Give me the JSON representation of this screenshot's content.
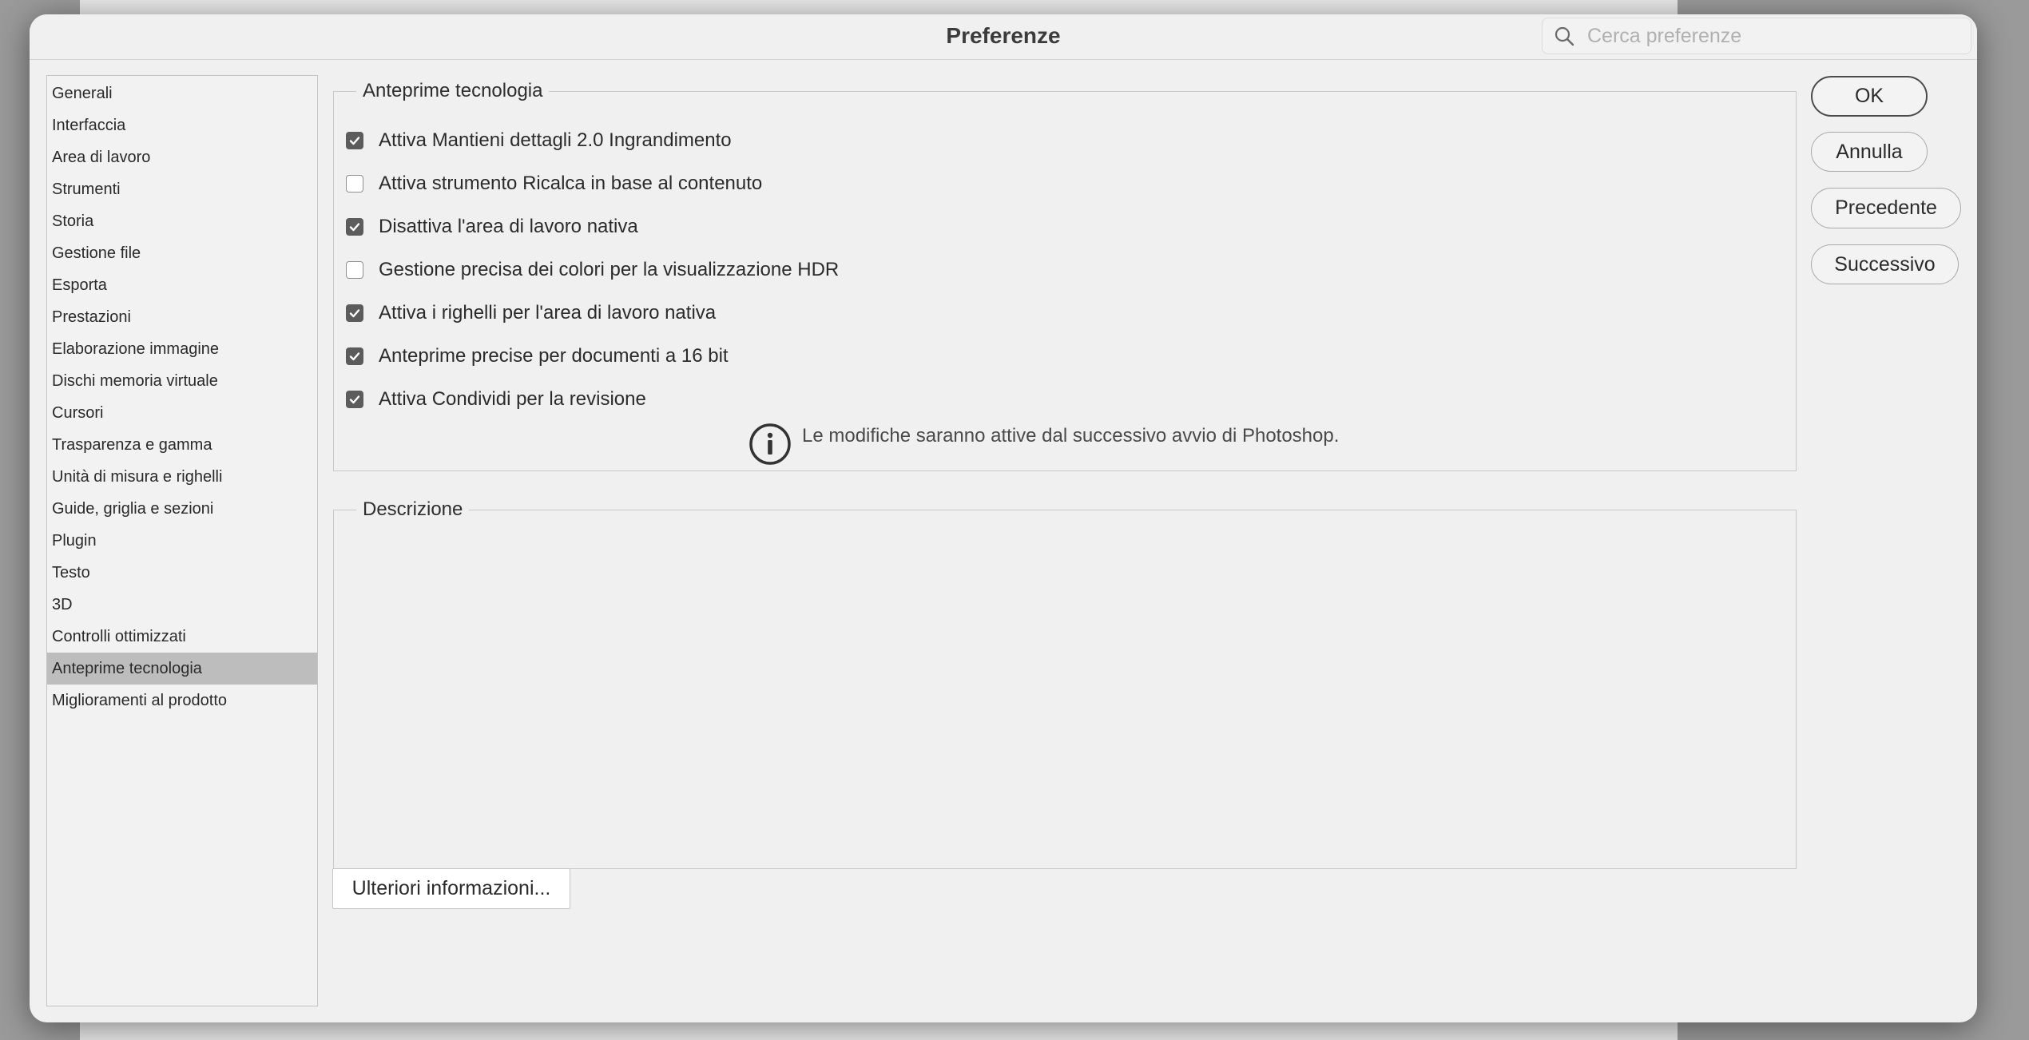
{
  "dialog": {
    "title": "Preferenze",
    "search_placeholder": "Cerca preferenze"
  },
  "sidebar": {
    "items": [
      {
        "label": "Generali",
        "selected": false
      },
      {
        "label": "Interfaccia",
        "selected": false
      },
      {
        "label": "Area di lavoro",
        "selected": false
      },
      {
        "label": "Strumenti",
        "selected": false
      },
      {
        "label": "Storia",
        "selected": false
      },
      {
        "label": "Gestione file",
        "selected": false
      },
      {
        "label": "Esporta",
        "selected": false
      },
      {
        "label": "Prestazioni",
        "selected": false
      },
      {
        "label": "Elaborazione immagine",
        "selected": false
      },
      {
        "label": "Dischi memoria virtuale",
        "selected": false
      },
      {
        "label": "Cursori",
        "selected": false
      },
      {
        "label": "Trasparenza e gamma",
        "selected": false
      },
      {
        "label": "Unità di misura e righelli",
        "selected": false
      },
      {
        "label": "Guide, griglia e sezioni",
        "selected": false
      },
      {
        "label": "Plugin",
        "selected": false
      },
      {
        "label": "Testo",
        "selected": false
      },
      {
        "label": "3D",
        "selected": false
      },
      {
        "label": "Controlli ottimizzati",
        "selected": false
      },
      {
        "label": "Anteprime tecnologia",
        "selected": true
      },
      {
        "label": "Miglioramenti al prodotto",
        "selected": false
      }
    ]
  },
  "tech_previews": {
    "legend": "Anteprime tecnologia",
    "options": [
      {
        "label": "Attiva Mantieni dettagli 2.0 Ingrandimento",
        "checked": true
      },
      {
        "label": "Attiva strumento Ricalca in base al contenuto",
        "checked": false
      },
      {
        "label": "Disattiva l'area di lavoro nativa",
        "checked": true
      },
      {
        "label": "Gestione precisa dei colori per la visualizzazione HDR",
        "checked": false
      },
      {
        "label": "Attiva i righelli per l'area di lavoro nativa",
        "checked": true
      },
      {
        "label": "Anteprime precise per documenti a 16 bit",
        "checked": true
      },
      {
        "label": "Attiva Condividi per la revisione",
        "checked": true
      }
    ],
    "info_icon": "info-circle-icon",
    "info_text": "Le modifiche saranno attive dal successivo avvio di Photoshop."
  },
  "description": {
    "legend": "Descrizione"
  },
  "more_info_button": "Ulteriori informazioni...",
  "buttons": {
    "ok": "OK",
    "cancel": "Annulla",
    "previous": "Precedente",
    "next": "Successivo"
  }
}
